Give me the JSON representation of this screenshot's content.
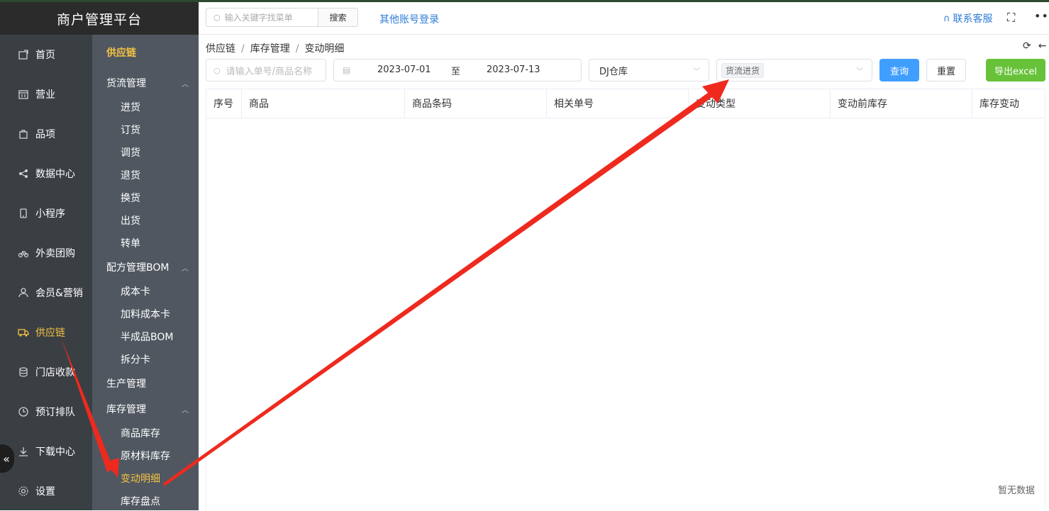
{
  "brand": {
    "title": "商户管理平台"
  },
  "nav1": {
    "items": [
      {
        "label": "首页",
        "icon": "home-icon"
      },
      {
        "label": "营业",
        "icon": "calendar-icon"
      },
      {
        "label": "品项",
        "icon": "bag-icon"
      },
      {
        "label": "数据中心",
        "icon": "share-icon"
      },
      {
        "label": "小程序",
        "icon": "phone-icon"
      },
      {
        "label": "外卖团购",
        "icon": "bike-icon"
      },
      {
        "label": "会员&营销",
        "icon": "user-icon"
      },
      {
        "label": "供应链",
        "icon": "truck-icon",
        "active": true
      },
      {
        "label": "门店收款",
        "icon": "database-icon"
      },
      {
        "label": "预订排队",
        "icon": "clock-icon"
      },
      {
        "label": "下载中心",
        "icon": "download-icon"
      },
      {
        "label": "设置",
        "icon": "gear-icon"
      }
    ],
    "collapse_glyph": "«"
  },
  "nav2": {
    "title": "供应链",
    "groups": [
      {
        "label": "货流管理",
        "chev": "︿",
        "subs": [
          "进货",
          "订货",
          "调货",
          "退货",
          "换货",
          "出货",
          "转单"
        ]
      },
      {
        "label": "配方管理BOM",
        "chev": "︿",
        "subs": [
          "成本卡",
          "加料成本卡",
          "半成品BOM",
          "拆分卡"
        ]
      },
      {
        "label": "生产管理",
        "chev": "",
        "subs": []
      },
      {
        "label": "库存管理",
        "chev": "︿",
        "subs": [
          "商品库存",
          "原材料库存",
          "变动明细",
          "库存盘点"
        ]
      }
    ],
    "active_sub": "变动明细"
  },
  "topbar": {
    "search_placeholder": "输入关键字找菜单",
    "search_button": "搜索",
    "other_login": "其他账号登录",
    "service": "联系客服",
    "fullscreen_glyph": "⛶",
    "more_glyph": "•••"
  },
  "breadcrumb": [
    "供应链",
    "库存管理",
    "变动明细"
  ],
  "breadcrumb_sep": "/",
  "filters": {
    "order_placeholder": "请输入单号/商品名称",
    "date_start": "2023-07-01",
    "date_to": "至",
    "date_end": "2023-07-13",
    "store": "DJ仓库",
    "type_tag": "货流进货",
    "query": "查询",
    "reset": "重置",
    "export": "导出excel"
  },
  "table": {
    "columns": [
      "序号",
      "商品",
      "商品条码",
      "相关单号",
      "变动类型",
      "变动前库存",
      "库存变动"
    ],
    "empty_text": "暂无数据"
  },
  "colors": {
    "accent_yellow": "#f5c242",
    "primary_blue": "#409eff",
    "export_green": "#67c23a",
    "annotation_red": "#ee2a1e"
  }
}
